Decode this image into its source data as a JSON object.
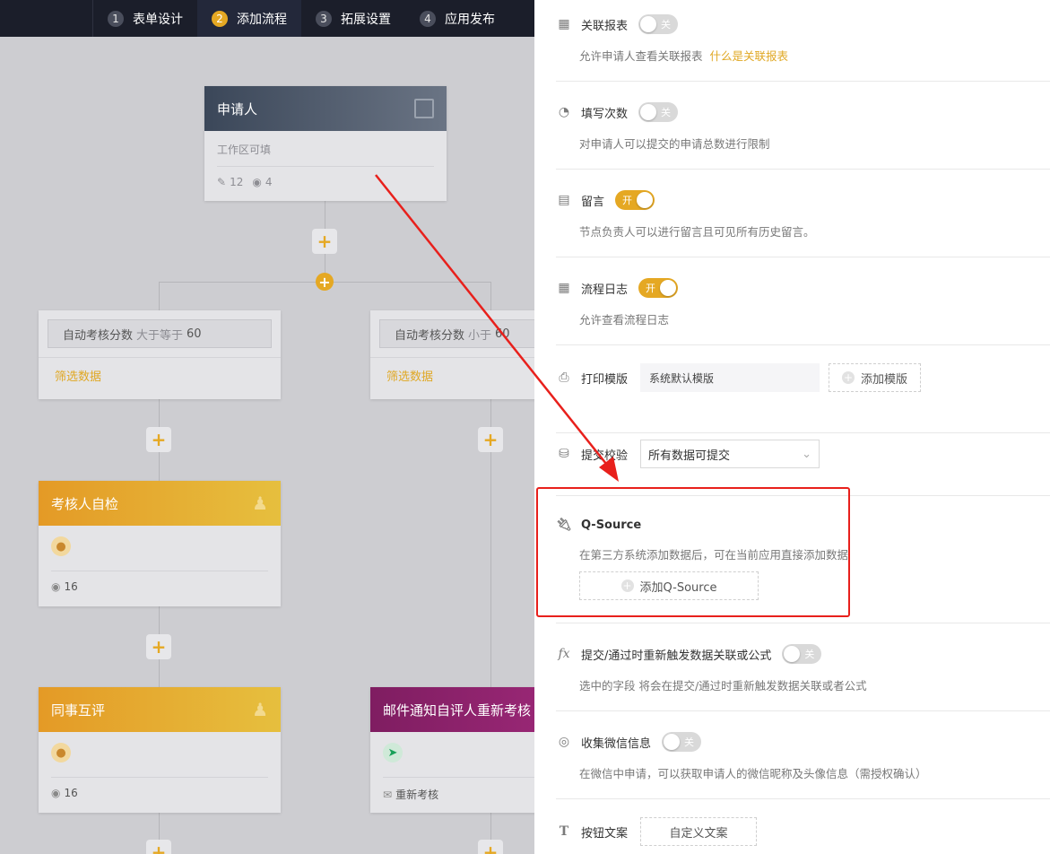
{
  "nav": {
    "steps": [
      {
        "num": "1",
        "label": "表单设计"
      },
      {
        "num": "2",
        "label": "添加流程"
      },
      {
        "num": "3",
        "label": "拓展设置"
      },
      {
        "num": "4",
        "label": "应用发布"
      }
    ]
  },
  "flow": {
    "applicant": {
      "title": "申请人",
      "subtitle": "工作区可填",
      "edit_count": "12",
      "view_count": "4"
    },
    "branch_left": {
      "field": "自动考核分数",
      "op": "大于等于",
      "value": "60",
      "link": "筛选数据"
    },
    "branch_right": {
      "field": "自动考核分数",
      "op": "小于",
      "value": "60",
      "link": "筛选数据"
    },
    "self_check": {
      "title": "考核人自检",
      "view_count": "16"
    },
    "peer_review": {
      "title": "同事互评",
      "view_count": "16"
    },
    "mail_node": {
      "title": "邮件通知自评人重新考核",
      "action": "重新考核"
    }
  },
  "settings": {
    "linked_report": {
      "title": "关联报表",
      "toggle": "关",
      "desc": "允许申请人查看关联报表",
      "link": "什么是关联报表"
    },
    "fill_count": {
      "title": "填写次数",
      "toggle": "关",
      "desc": "对申请人可以提交的申请总数进行限制"
    },
    "comment": {
      "title": "留言",
      "toggle": "开",
      "desc": "节点负责人可以进行留言且可见所有历史留言。"
    },
    "flow_log": {
      "title": "流程日志",
      "toggle": "开",
      "desc": "允许查看流程日志"
    },
    "print_template": {
      "title": "打印模版",
      "value": "系统默认模版",
      "add_label": "添加模版"
    },
    "submit_check": {
      "title": "提交校验",
      "value": "所有数据可提交"
    },
    "qsource": {
      "title": "Q-Source",
      "desc": "在第三方系统添加数据后，可在当前应用直接添加数据",
      "add_label": "添加Q-Source"
    },
    "retrigger": {
      "title": "提交/通过时重新触发数据关联或公式",
      "toggle": "关",
      "desc": "选中的字段 将会在提交/通过时重新触发数据关联或者公式"
    },
    "wechat": {
      "title": "收集微信信息",
      "toggle": "关",
      "desc": "在微信中申请，可以获取申请人的微信昵称及头像信息（需授权确认）"
    },
    "button_text": {
      "title": "按钮文案",
      "button_label": "自定义文案"
    }
  },
  "colors": {
    "accent": "#e5a823",
    "highlight": "#e8201c"
  }
}
